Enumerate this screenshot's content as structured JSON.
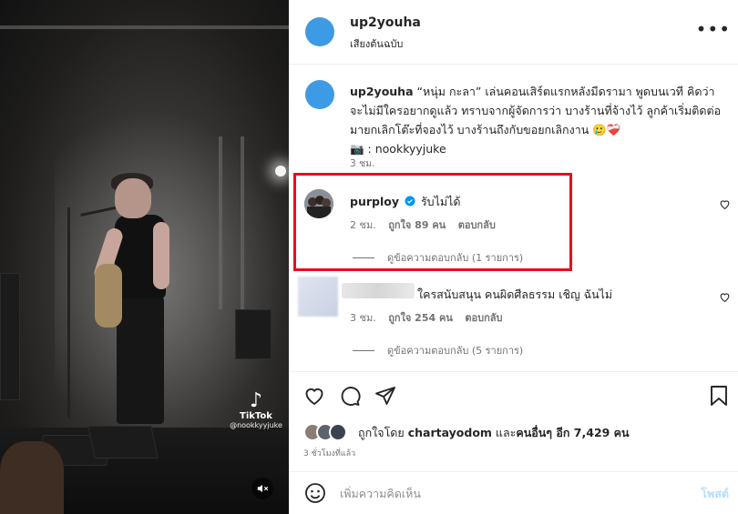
{
  "video": {
    "watermark_brand": "TikTok",
    "watermark_handle": "@nookkyyjuke",
    "mute_icon": "speaker-muted-icon"
  },
  "header": {
    "username": "up2youha",
    "audio": "เสียงต้นฉบับ",
    "more_icon": "more-dots-icon",
    "avatar_color": "#3d9be6"
  },
  "caption": {
    "username": "up2youha",
    "text": "“หนุ่ม กะลา” เล่นคอนเสิร์ตแรกหลังมีดรามา พูดบนเวที คิดว่าจะไม่มีใครอยากดูแล้ว ทราบจากผู้จัดการว่า บางร้านที่จ้างไว้ ลูกค้าเริ่มติดต่อมายกเลิกโต๊ะที่จองไว้ บางร้านถึงกับขอยกเลิกงาน 🥲❤️‍🩹",
    "credit_prefix": "📷 : ",
    "credit": "nookkyyjuke",
    "time": "3 ชม."
  },
  "comments": [
    {
      "username": "purploy",
      "verified": true,
      "text": "รับไม่ได้",
      "time": "2 ชม.",
      "likes": "ถูกใจ 89 คน",
      "reply": "ตอบกลับ",
      "view_replies": "ดูข้อความตอบกลับ (1 รายการ)"
    },
    {
      "username": "",
      "text": "ใครสนับสนุน คนผิดศีลธรรม เชิญ ฉันไม่",
      "time": "3 ชม.",
      "likes": "ถูกใจ 254 คน",
      "reply": "ตอบกลับ",
      "view_replies": "ดูข้อความตอบกลับ (5 รายการ)"
    }
  ],
  "actions": {
    "liked_by_prefix": "ถูกใจโดย ",
    "liked_by_user": "chartayodom",
    "liked_by_mid": " และ",
    "liked_by_others": "คนอื่นๆ อีก 7,429 คน",
    "ago": "3 ชั่วโมงที่แล้ว"
  },
  "composer": {
    "placeholder": "เพิ่มความคิดเห็น",
    "post_label": "โพสต์"
  },
  "colors": {
    "highlight_border": "#e4101f",
    "verified_badge": "#0095f6",
    "post_disabled": "#b2dffc"
  }
}
